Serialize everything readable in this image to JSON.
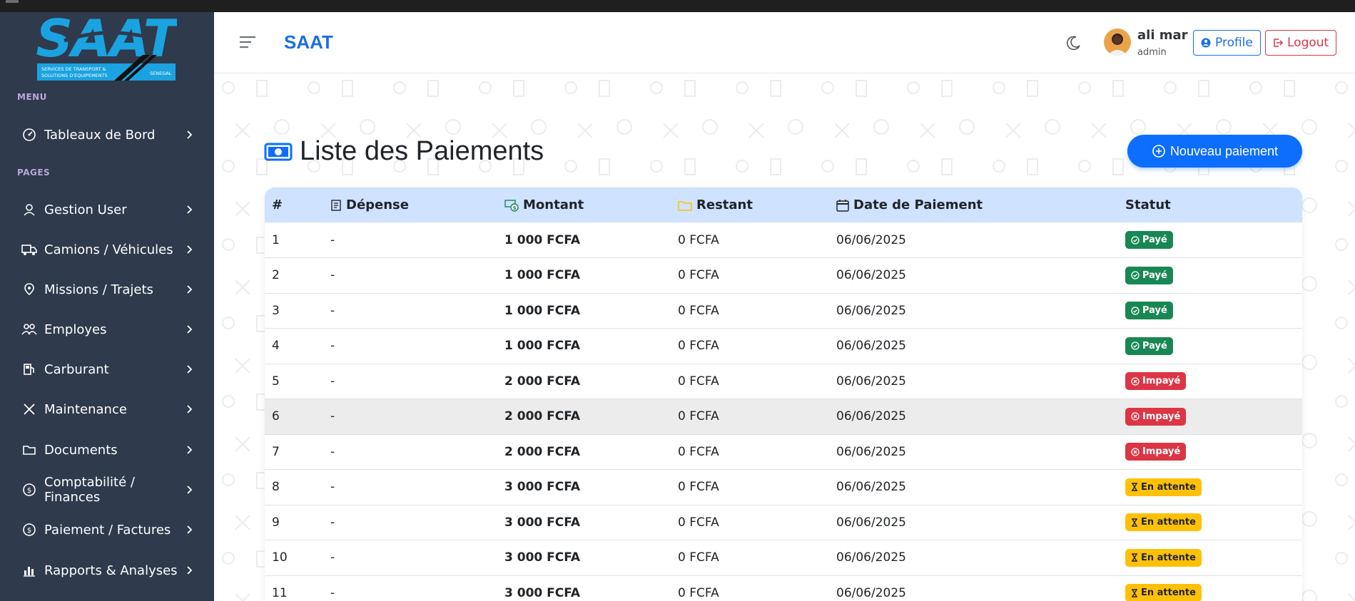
{
  "app": {
    "logo_text": "SAAT",
    "logo_subtitle": "SERVICES DE TRANSPORT & SOLUTIONS D'EQUIPEMENTS",
    "logo_country": "SENEGAL",
    "brand": "SAAT"
  },
  "sidebar": {
    "menu_title": "MENU",
    "pages_title": "PAGES",
    "menu_items": [
      {
        "label": "Tableaux de Bord",
        "icon": "speedometer-icon"
      }
    ],
    "page_items": [
      {
        "label": "Gestion User",
        "icon": "user-icon"
      },
      {
        "label": "Camions / Véhicules",
        "icon": "truck-icon"
      },
      {
        "label": "Missions / Trajets",
        "icon": "map-icon"
      },
      {
        "label": "Employes",
        "icon": "people-icon"
      },
      {
        "label": "Carburant",
        "icon": "fuel-pump-icon"
      },
      {
        "label": "Maintenance",
        "icon": "tools-icon"
      },
      {
        "label": "Documents",
        "icon": "folder-icon"
      },
      {
        "label": "Comptabilité / Finances",
        "icon": "coin-icon"
      },
      {
        "label": "Paiement / Factures",
        "icon": "coin-icon"
      },
      {
        "label": "Rapports & Analyses",
        "icon": "bar-chart-icon"
      }
    ]
  },
  "header": {
    "user_name": "ali mar",
    "user_role": "admin",
    "profile_label": "Profile",
    "logout_label": "Logout"
  },
  "page": {
    "title": "Liste des Paiements",
    "new_button": "Nouveau paiement"
  },
  "table": {
    "columns": [
      "#",
      "Dépense",
      "Montant",
      "Restant",
      "Date de Paiement",
      "Statut"
    ],
    "rows": [
      {
        "num": "1",
        "depense": "-",
        "montant": "1 000 FCFA",
        "restant": "0 FCFA",
        "date": "06/06/2025",
        "statut": "Payé",
        "type": "paye"
      },
      {
        "num": "2",
        "depense": "-",
        "montant": "1 000 FCFA",
        "restant": "0 FCFA",
        "date": "06/06/2025",
        "statut": "Payé",
        "type": "paye"
      },
      {
        "num": "3",
        "depense": "-",
        "montant": "1 000 FCFA",
        "restant": "0 FCFA",
        "date": "06/06/2025",
        "statut": "Payé",
        "type": "paye"
      },
      {
        "num": "4",
        "depense": "-",
        "montant": "1 000 FCFA",
        "restant": "0 FCFA",
        "date": "06/06/2025",
        "statut": "Payé",
        "type": "paye"
      },
      {
        "num": "5",
        "depense": "-",
        "montant": "2 000 FCFA",
        "restant": "0 FCFA",
        "date": "06/06/2025",
        "statut": "Impayé",
        "type": "impaye"
      },
      {
        "num": "6",
        "depense": "-",
        "montant": "2 000 FCFA",
        "restant": "0 FCFA",
        "date": "06/06/2025",
        "statut": "Impayé",
        "type": "impaye"
      },
      {
        "num": "7",
        "depense": "-",
        "montant": "2 000 FCFA",
        "restant": "0 FCFA",
        "date": "06/06/2025",
        "statut": "Impayé",
        "type": "impaye"
      },
      {
        "num": "8",
        "depense": "-",
        "montant": "3 000 FCFA",
        "restant": "0 FCFA",
        "date": "06/06/2025",
        "statut": "En attente",
        "type": "attente"
      },
      {
        "num": "9",
        "depense": "-",
        "montant": "3 000 FCFA",
        "restant": "0 FCFA",
        "date": "06/06/2025",
        "statut": "En attente",
        "type": "attente"
      },
      {
        "num": "10",
        "depense": "-",
        "montant": "3 000 FCFA",
        "restant": "0 FCFA",
        "date": "06/06/2025",
        "statut": "En attente",
        "type": "attente"
      },
      {
        "num": "11",
        "depense": "-",
        "montant": "3 000 FCFA",
        "restant": "0 FCFA",
        "date": "06/06/2025",
        "statut": "En attente",
        "type": "attente"
      }
    ]
  },
  "colors": {
    "sidebar_bg": "#2f3a4d",
    "primary": "#0d6efd",
    "header_row": "#cfe2ff",
    "success": "#198754",
    "danger": "#dc3545",
    "warning": "#ffc107"
  }
}
